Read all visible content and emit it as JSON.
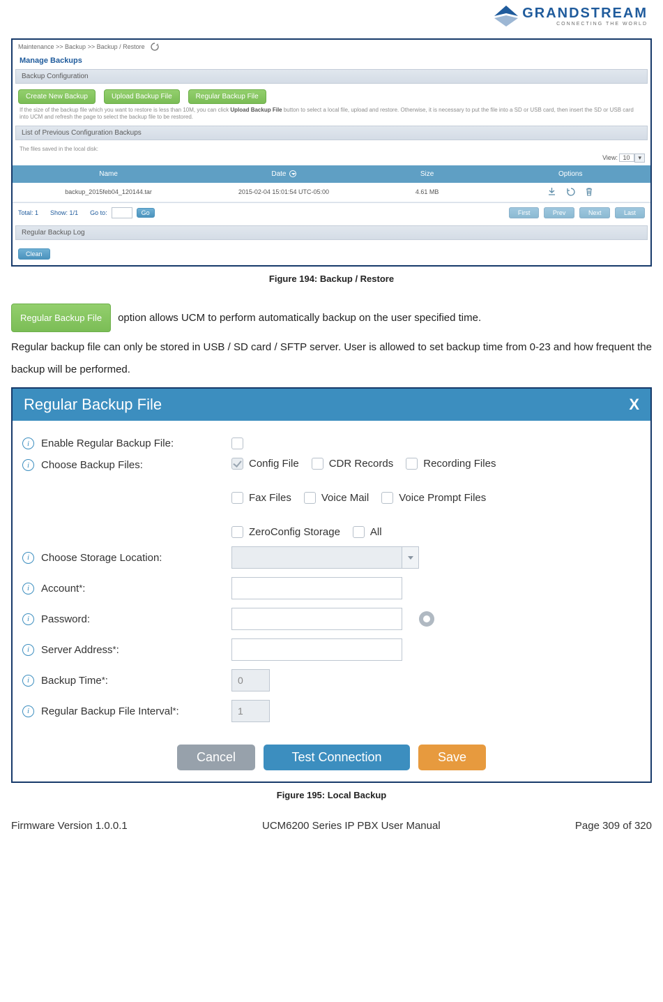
{
  "brand": {
    "name": "GRANDSTREAM",
    "tagline": "CONNECTING THE WORLD"
  },
  "fig194": {
    "breadcrumb": "Maintenance >> Backup >> Backup / Restore",
    "manage_title": "Manage Backups",
    "bar_backup_config": "Backup Configuration",
    "btn_create": "Create New Backup",
    "btn_upload": "Upload Backup File",
    "btn_regular": "Regular Backup File",
    "help1_a": "If the size of the backup file which you want to restore is less than 10M, you can click ",
    "help1_b": "Upload Backup File",
    "help1_c": " button to select a local file, upload and restore. Otherwise, it is necessary to put the file into a SD or USB card, then insert the SD or USB card into UCM and refresh the page to select the backup file to be restored.",
    "bar_list": "List of Previous Configuration Backups",
    "sub_help": "The files saved in the local disk:",
    "view_label": "View:",
    "view_value": "10",
    "th_name": "Name",
    "th_date": "Date",
    "th_size": "Size",
    "th_opts": "Options",
    "row_name": "backup_2015feb04_120144.tar",
    "row_date": "2015-02-04 15:01:54 UTC-05:00",
    "row_size": "4.61 MB",
    "total": "Total: 1",
    "show": "Show: 1/1",
    "goto": "Go to:",
    "go": "Go",
    "first": "First",
    "prev": "Prev",
    "next": "Next",
    "last": "Last",
    "bar_log": "Regular Backup Log",
    "clean": "Clean",
    "caption": "Figure 194: Backup / Restore"
  },
  "paragraph": {
    "btn_label": "Regular Backup File",
    "inline": " option allows UCM to perform automatically backup on the user specified time.",
    "rest": "Regular backup file can only be stored in USB / SD card / SFTP server. User is allowed to set backup time from 0-23 and how frequent the backup will be performed."
  },
  "fig195": {
    "title": "Regular Backup File",
    "close": "X",
    "lbl_enable": "Enable Regular Backup File:",
    "lbl_choose_files": "Choose Backup Files:",
    "files": {
      "config": "Config File",
      "cdr": "CDR Records",
      "rec": "Recording Files",
      "fax": "Fax Files",
      "vm": "Voice Mail",
      "prompt": "Voice Prompt Files",
      "zero": "ZeroConfig Storage",
      "all": "All"
    },
    "lbl_storage": "Choose Storage Location:",
    "lbl_account": "Account",
    "lbl_password": "Password:",
    "lbl_server": "Server Address",
    "lbl_time": "Backup Time",
    "lbl_interval": "Regular Backup File Interval",
    "val_time": "0",
    "val_interval": "1",
    "btn_cancel": "Cancel",
    "btn_test": "Test Connection",
    "btn_save": "Save",
    "caption": "Figure 195: Local Backup"
  },
  "footer": {
    "left": "Firmware Version 1.0.0.1",
    "center": "UCM6200 Series IP PBX User Manual",
    "right": "Page 309 of 320"
  }
}
